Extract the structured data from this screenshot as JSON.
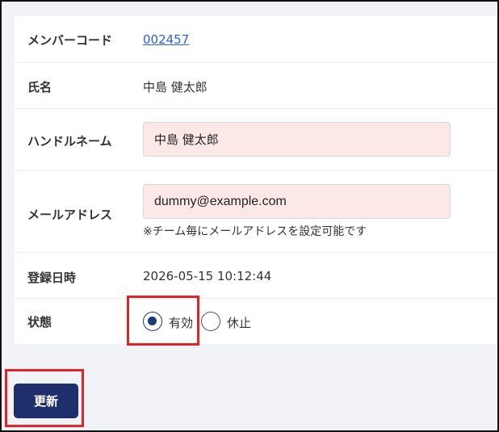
{
  "form": {
    "member_code": {
      "label": "メンバーコード",
      "value": "002457"
    },
    "name": {
      "label": "氏名",
      "value": "中島 健太郎"
    },
    "handle": {
      "label": "ハンドルネーム",
      "value": "中島 健太郎"
    },
    "email": {
      "label": "メールアドレス",
      "value": "dummy@example.com",
      "note": "※チーム毎にメールアドレスを設定可能です"
    },
    "registered": {
      "label": "登録日時",
      "value": "2026-05-15 10:12:44"
    },
    "status": {
      "label": "状態",
      "options": [
        {
          "label": "有効",
          "selected": true
        },
        {
          "label": "休止",
          "selected": false
        }
      ]
    }
  },
  "actions": {
    "update_label": "更新"
  },
  "colors": {
    "highlight": "#e0242a",
    "primary": "#1f2f6d",
    "input_bg": "#fde8e8",
    "link": "#2b5fd9"
  }
}
